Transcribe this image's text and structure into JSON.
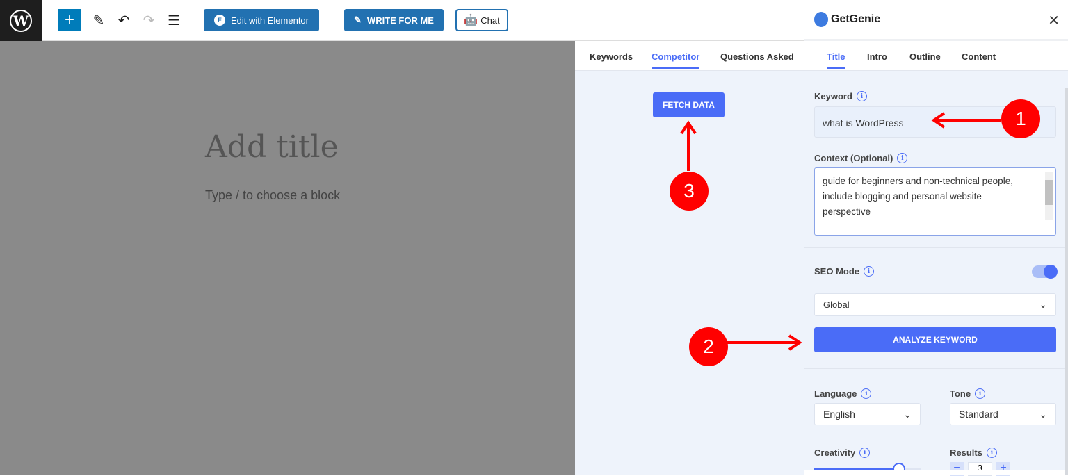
{
  "toolbar": {
    "elementor": "Edit with Elementor",
    "write": "WRITE FOR ME",
    "chat": "Chat"
  },
  "editor": {
    "title_placeholder": "Add title",
    "block_placeholder": "Type / to choose a block"
  },
  "competitor": {
    "tabs": [
      "Keywords",
      "Competitor",
      "Questions Asked"
    ],
    "active_tab": "Competitor",
    "fetch": "FETCH DATA"
  },
  "genie": {
    "brand": "GetGenie",
    "tabs": [
      "Title",
      "Intro",
      "Outline",
      "Content"
    ],
    "active_tab": "Title",
    "keyword_label": "Keyword",
    "keyword_value": "what is WordPress",
    "context_label": "Context (Optional)",
    "context_value": "guide for beginners and non-technical people, include blogging and personal website perspective",
    "seo_label": "SEO Mode",
    "seo_on": true,
    "region": "Global",
    "analyze": "ANALYZE KEYWORD",
    "language_label": "Language",
    "language": "English",
    "tone_label": "Tone",
    "tone": "Standard",
    "creativity_label": "Creativity",
    "creativity_level": 0.8,
    "results_label": "Results",
    "results": "3"
  },
  "annotations": [
    "1",
    "2",
    "3"
  ],
  "colors": {
    "accent": "#4a6cf7",
    "wp_blue": "#2271b1",
    "annotation": "#ff0000"
  }
}
